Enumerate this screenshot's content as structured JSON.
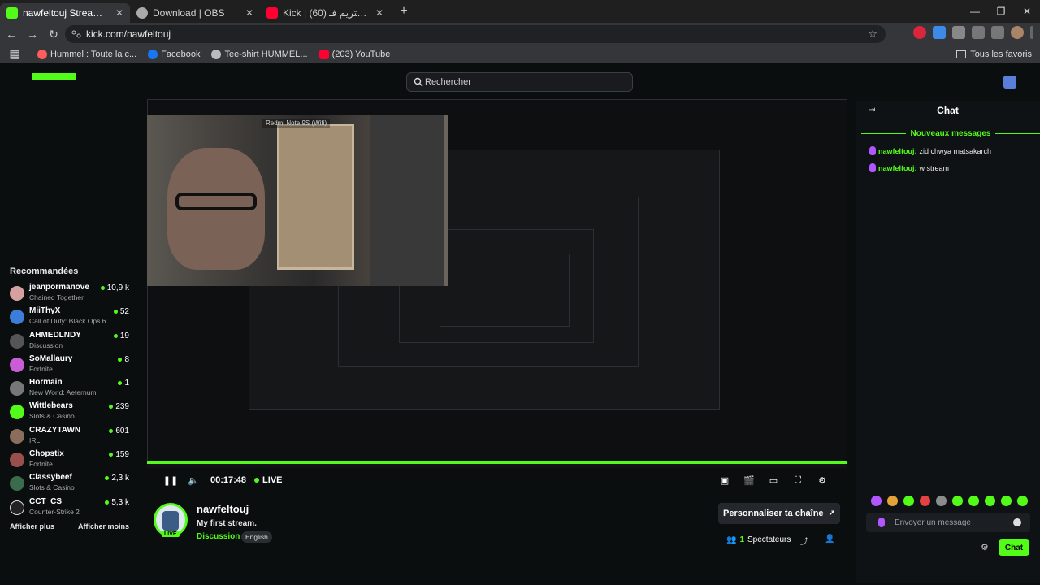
{
  "tabs": [
    {
      "title": "nawfeltouj Stream - Watch Live",
      "active": true,
      "favicon_color": "#53fc18"
    },
    {
      "title": "Download | OBS",
      "active": false,
      "favicon_color": "#aaaaaa"
    },
    {
      "title": "Kick | كيفاش دير ستريم فـ (60)",
      "active": false,
      "favicon_color": "#ff0033"
    }
  ],
  "address": {
    "url": "kick.com/nawfeltouj"
  },
  "bookmarks": [
    {
      "label": "Hummel : Toute la c...",
      "color": "#ff5c5c"
    },
    {
      "label": "Facebook",
      "color": "#1877f2"
    },
    {
      "label": "Tee-shirt HUMMEL...",
      "color": "#bbbbbb"
    },
    {
      "label": "(203) YouTube",
      "color": "#ff0033"
    }
  ],
  "bookmarks_right": "Tous les favoris",
  "search": {
    "placeholder": "Rechercher"
  },
  "sidebar": {
    "title": "Recommandées",
    "items": [
      {
        "name": "jeanpormanove",
        "category": "Chained Together",
        "count": "10,9 k",
        "color": "#d6a0a0"
      },
      {
        "name": "MiiThyX",
        "category": "Call of Duty: Black Ops 6",
        "count": "52",
        "color": "#3b7dd8"
      },
      {
        "name": "AHMEDLNDY",
        "category": "Discussion",
        "count": "19",
        "color": "#555"
      },
      {
        "name": "SoMallaury",
        "category": "Fortnite",
        "count": "8",
        "color": "#c85dd6"
      },
      {
        "name": "Hormain",
        "category": "New World: Aeternum",
        "count": "1",
        "color": "#777"
      },
      {
        "name": "Wittlebears",
        "category": "Slots & Casino",
        "count": "239",
        "color": "#53fc18"
      },
      {
        "name": "CRAZYTAWN",
        "category": "IRL",
        "count": "601",
        "color": "#8a6d5c"
      },
      {
        "name": "Chopstix",
        "category": "Fortnite",
        "count": "159",
        "color": "#9a4f4f"
      },
      {
        "name": "Classybeef",
        "category": "Slots & Casino",
        "count": "2,3 k",
        "color": "#3a6b4c"
      },
      {
        "name": "CCT_CS",
        "category": "Counter-Strike 2",
        "count": "5,3 k",
        "color": "#222"
      }
    ],
    "show_more": "Afficher plus",
    "show_less": "Afficher moins"
  },
  "webcam_label": "Redmi Note 9S (Wifi)",
  "player": {
    "time": "00:17:48",
    "live": "LIVE",
    "progress": 1.0
  },
  "stream": {
    "username": "nawfeltouj",
    "title": "My first stream.",
    "category": "Discussion",
    "language": "English",
    "live_badge": "LIVE",
    "customize_button": "Personnaliser ta chaîne",
    "viewer_count": "1",
    "viewer_label": "Spectateurs"
  },
  "chat": {
    "title": "Chat",
    "new_messages": "Nouveaux messages",
    "messages": [
      {
        "user": "nawfeltouj:",
        "text": "zid chwya matsakarch"
      },
      {
        "user": "nawfeltouj:",
        "text": "w stream"
      }
    ],
    "input_placeholder": "Envoyer un message",
    "send_label": "Chat"
  },
  "colors": {
    "accent": "#53fc18",
    "background": "#0b0e0f"
  }
}
